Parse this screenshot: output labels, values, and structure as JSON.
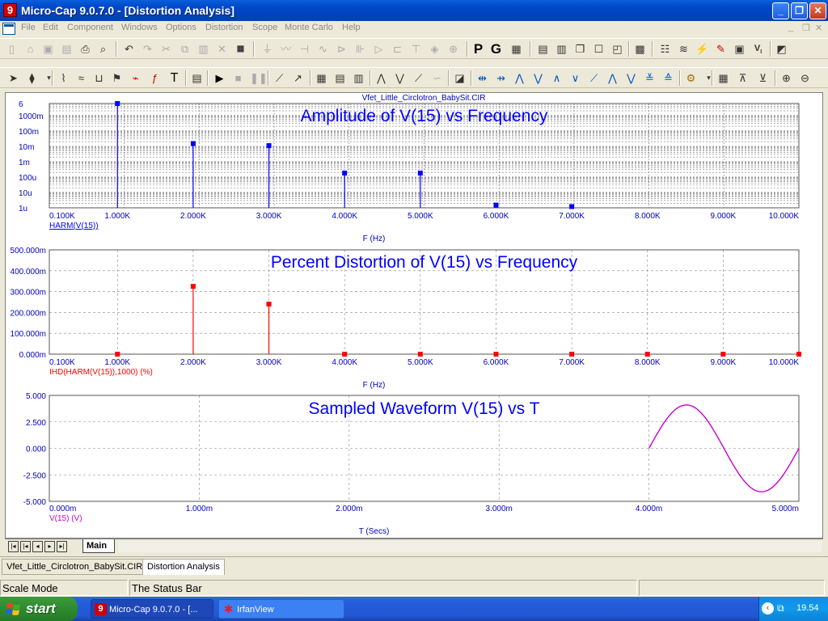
{
  "window": {
    "title": "Micro-Cap 9.0.7.0 - [Distortion Analysis]",
    "minimize": "_",
    "restore": "❐",
    "close": "✕"
  },
  "menu": [
    "File",
    "Edit",
    "Component",
    "Windows",
    "Options",
    "Distortion",
    "Scope",
    "Monte Carlo",
    "Help"
  ],
  "mdi_controls": [
    "_",
    "❐",
    "✕"
  ],
  "toolbar1_icons": [
    "new-icon",
    "open-icon",
    "save-icon",
    "save-all-icon",
    "print-icon",
    "print-preview-icon",
    "undo-icon",
    "redo-icon",
    "cut-icon",
    "copy-icon",
    "paste-icon",
    "delete-icon",
    "select-all-icon",
    "ground-icon",
    "resistor-icon",
    "capacitor-icon",
    "inductor-icon",
    "diode-icon",
    "battery-icon",
    "opamp-icon",
    "npn-icon",
    "jfet-icon",
    "node-icon",
    "source-icon"
  ],
  "toolbar1_text_buttons": [
    "P",
    "G"
  ],
  "toolbar2_icons": [
    "select-arrow-icon",
    "component-icon",
    "wire-icon",
    "text-icon",
    "run-icon",
    "stop-icon",
    "pause-icon",
    "zoom-in-icon",
    "zoom-out-icon"
  ],
  "toolbar2_text_buttons": [
    "T"
  ],
  "plot": {
    "circuit_name": "Vfet_Little_Circlotron_BabySit.CIR",
    "page_tab": "Main",
    "nav_buttons": [
      "◄|",
      "|◄",
      "◄",
      "►",
      "►|"
    ]
  },
  "doc_tabs": [
    "Vfet_Little_Circlotron_BabySit.CIR",
    "Distortion Analysis"
  ],
  "status": {
    "mode": "Scale Mode",
    "message": "The Status Bar"
  },
  "taskbar": {
    "start": "start",
    "tasks": [
      "Micro-Cap 9.0.7.0 - [...",
      "IrfanView"
    ],
    "clock": "19.54"
  },
  "colors": {
    "amplitude_trace": "#0000ff",
    "distortion_trace": "#ff0000",
    "waveform_trace": "#cc00cc",
    "title_text": "#0000ff"
  },
  "chart_data": [
    {
      "type": "bar",
      "title": "Amplitude of V(15) vs Frequency",
      "xlabel": "F (Hz)",
      "ylabel": "",
      "series_label": "HARM(V(15))",
      "yscale": "log",
      "xlim": [
        100,
        10000
      ],
      "x_ticks": [
        "0.100K",
        "1.000K",
        "2.000K",
        "3.000K",
        "4.000K",
        "5.000K",
        "6.000K",
        "7.000K",
        "8.000K",
        "9.000K",
        "10.000K"
      ],
      "y_ticks": [
        "6",
        "1000m",
        "100m",
        "10m",
        "1m",
        "100u",
        "10u",
        "1u"
      ],
      "points": [
        {
          "x": 1000,
          "y": 6
        },
        {
          "x": 2000,
          "y": 0.015
        },
        {
          "x": 3000,
          "y": 0.011
        },
        {
          "x": 4000,
          "y": 0.00018
        },
        {
          "x": 5000,
          "y": 0.00018
        },
        {
          "x": 6000,
          "y": 1.5e-06
        },
        {
          "x": 7000,
          "y": 1.2e-06
        }
      ]
    },
    {
      "type": "bar",
      "title": "Percent Distortion of V(15) vs Frequency",
      "xlabel": "F (Hz)",
      "ylabel": "",
      "series_label": "IHD(HARM(V(15)),1000) (%)",
      "xlim": [
        100,
        10000
      ],
      "ylim": [
        0,
        500
      ],
      "x_ticks": [
        "0.100K",
        "1.000K",
        "2.000K",
        "3.000K",
        "4.000K",
        "5.000K",
        "6.000K",
        "7.000K",
        "8.000K",
        "9.000K",
        "10.000K"
      ],
      "y_ticks": [
        "500.000m",
        "400.000m",
        "300.000m",
        "200.000m",
        "100.000m",
        "0.000m"
      ],
      "points": [
        {
          "x": 1000,
          "y": 0
        },
        {
          "x": 2000,
          "y": 325
        },
        {
          "x": 3000,
          "y": 240
        },
        {
          "x": 4000,
          "y": 0
        },
        {
          "x": 5000,
          "y": 0
        },
        {
          "x": 6000,
          "y": 0
        },
        {
          "x": 7000,
          "y": 0
        },
        {
          "x": 8000,
          "y": 0
        },
        {
          "x": 9000,
          "y": 0
        },
        {
          "x": 10000,
          "y": 0
        }
      ]
    },
    {
      "type": "line",
      "title": "Sampled Waveform  V(15) vs T",
      "xlabel": "T (Secs)",
      "ylabel": "",
      "series_label": "V(15) (V)",
      "xlim": [
        0,
        5
      ],
      "ylim": [
        -5,
        5
      ],
      "x_ticks": [
        "0.000m",
        "1.000m",
        "2.000m",
        "3.000m",
        "4.000m",
        "5.000m"
      ],
      "y_ticks": [
        "5.000",
        "2.500",
        "0.000",
        "-2.500",
        "-5.000"
      ],
      "waveform": {
        "start_ms": 4.0,
        "end_ms": 5.0,
        "amplitude": 4.1,
        "frequency_hz": 1000
      }
    }
  ]
}
